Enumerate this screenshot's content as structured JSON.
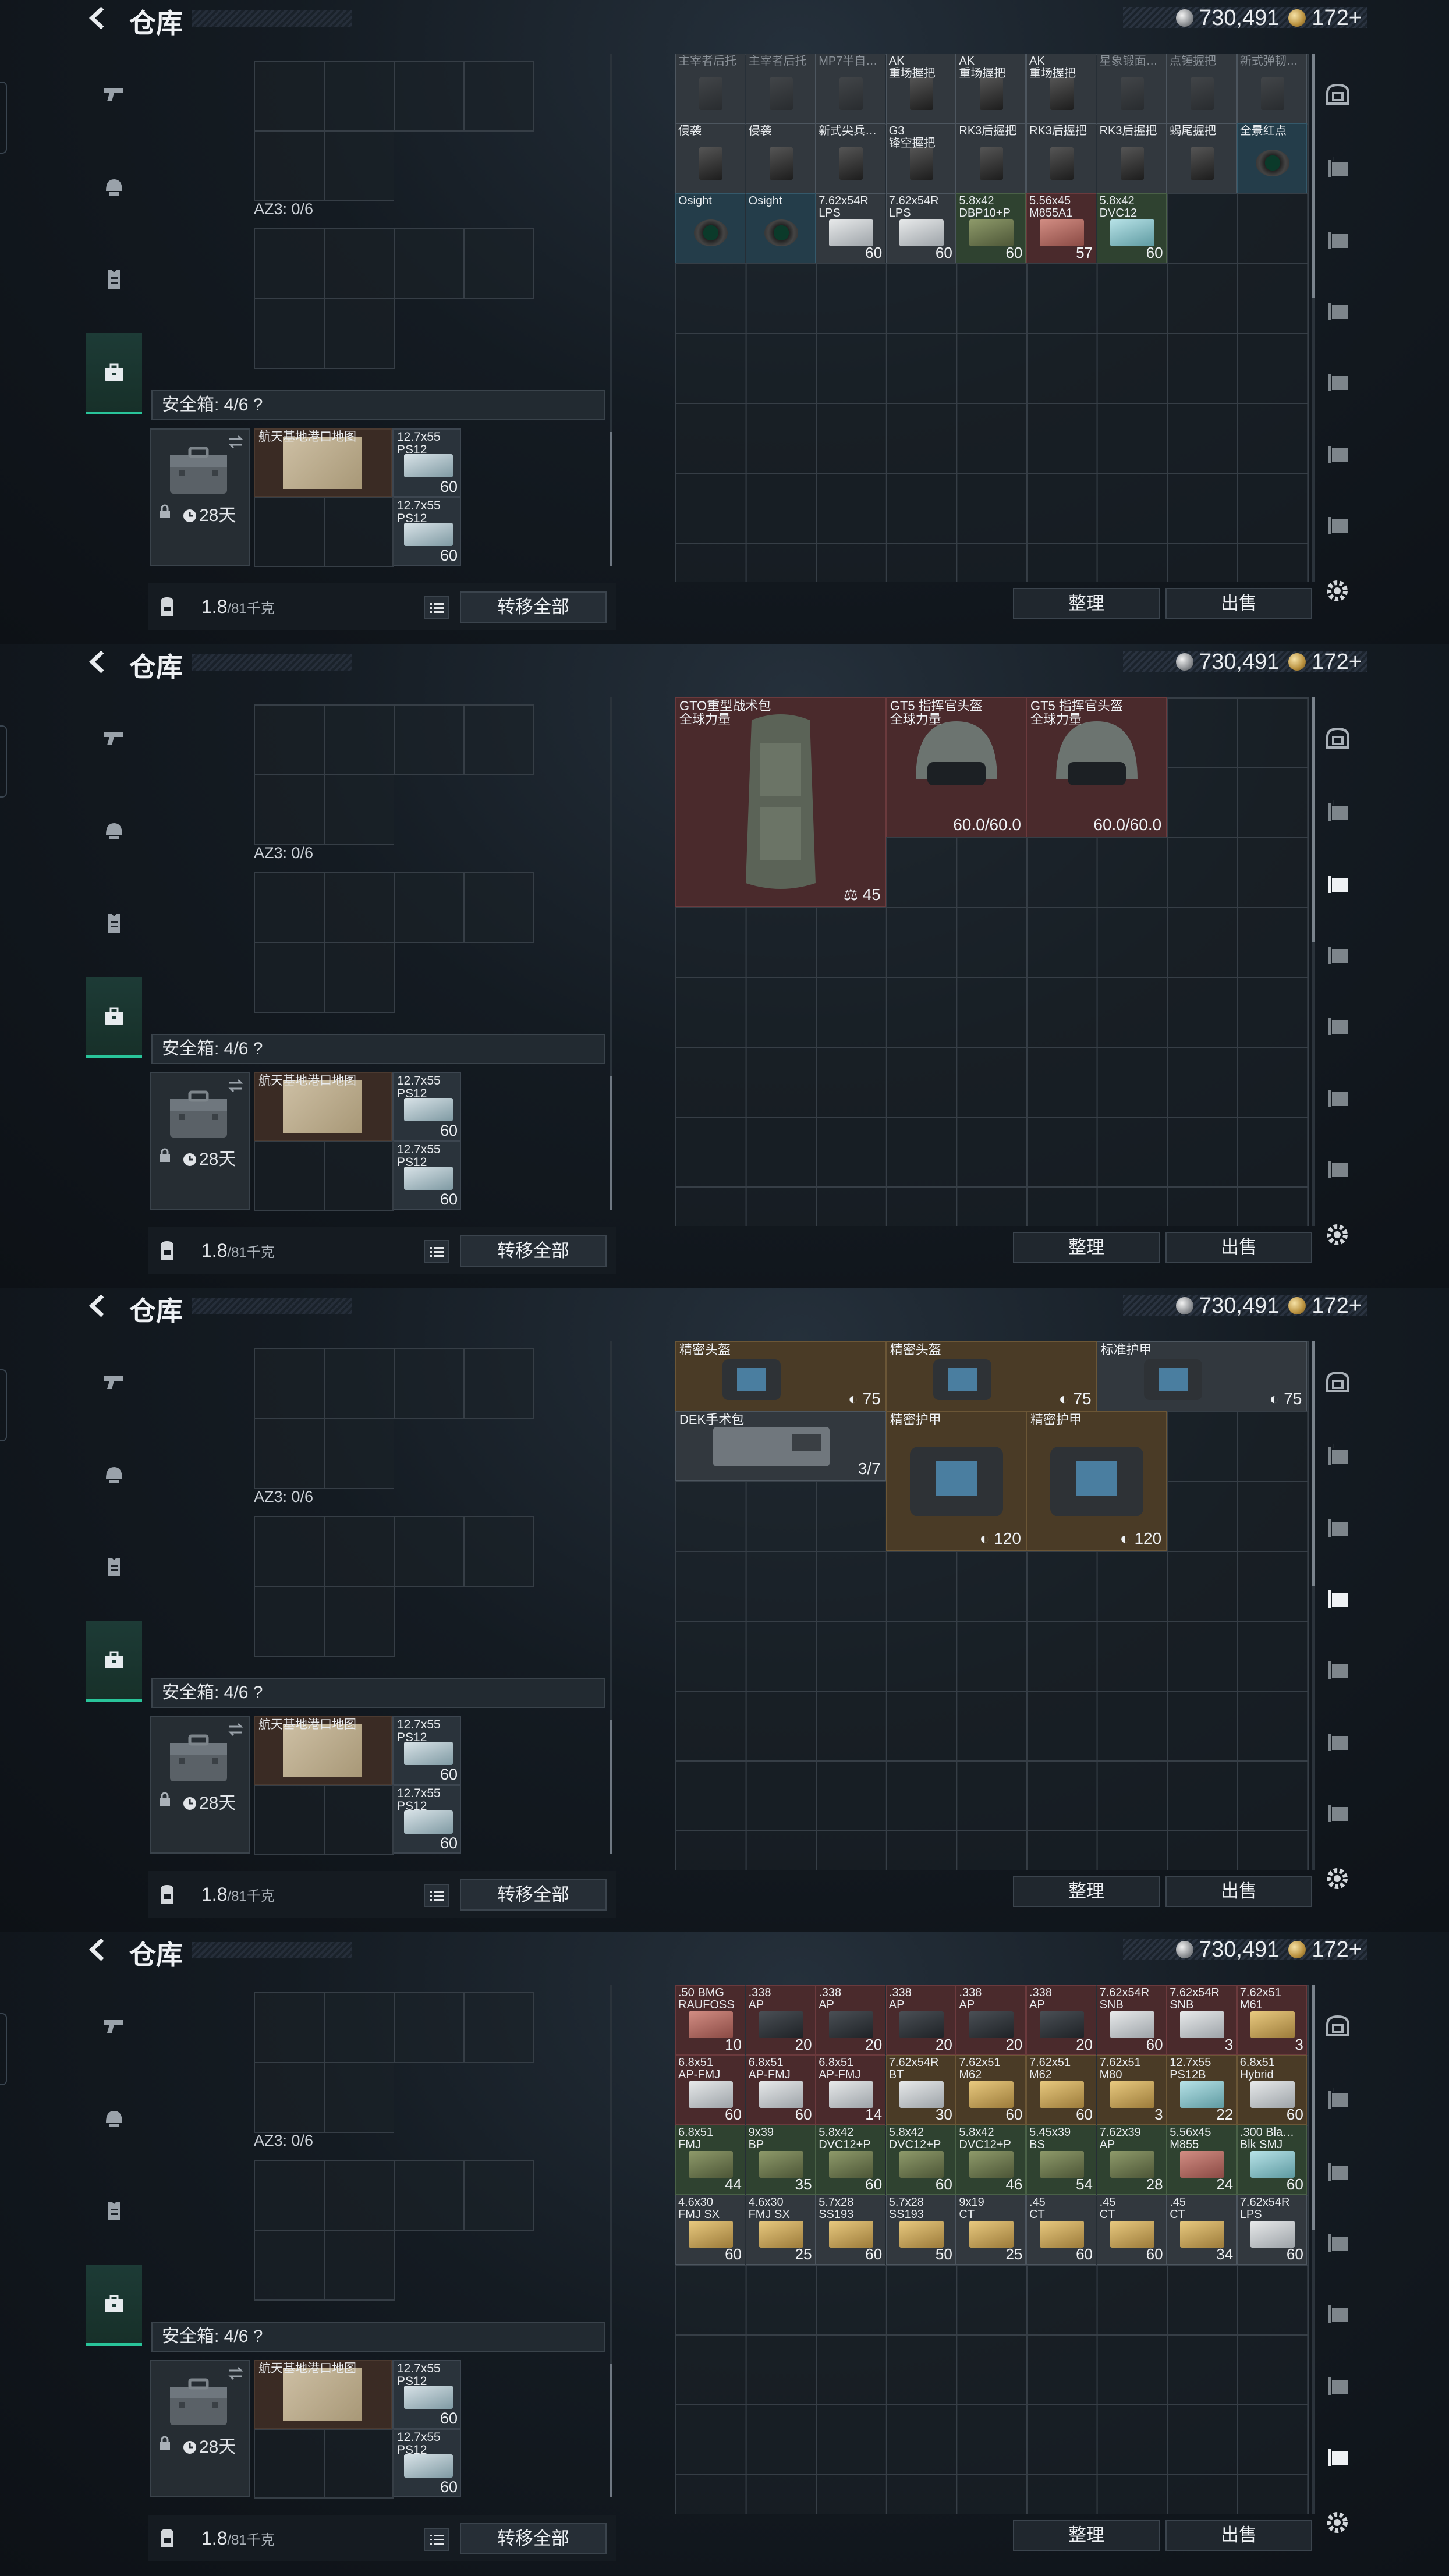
{
  "header": {
    "title": "仓库",
    "silver": "730,491",
    "gold": "172+"
  },
  "storage": {
    "az_label": "AZ3: 0/6",
    "safe_label": "安全箱: 4/6  ?",
    "case_days": "28天",
    "map_item": "航天基地港口地图",
    "ammo1_name": "12.7x55\nPS12",
    "ammo1_count": "60",
    "ammo2_name": "12.7x55\nPS12",
    "ammo2_count": "60",
    "weight_val": "1.8",
    "weight_unit": "/81千克",
    "transfer_all": "转移全部"
  },
  "buttons": {
    "sort": "整理",
    "sell": "出售"
  },
  "panel1_items": [
    {
      "name": "主宰者后托",
      "count": "",
      "style": "gray dim",
      "img": "grip"
    },
    {
      "name": "主宰者后托",
      "count": "",
      "style": "gray dim",
      "img": "grip"
    },
    {
      "name": "MP7半自…",
      "count": "",
      "style": "gray dim",
      "img": "grip"
    },
    {
      "name": "AK\n重场握把",
      "count": "",
      "style": "gray",
      "img": "grip"
    },
    {
      "name": "AK\n重场握把",
      "count": "",
      "style": "gray",
      "img": "grip"
    },
    {
      "name": "AK\n重场握把",
      "count": "",
      "style": "gray",
      "img": "grip"
    },
    {
      "name": "星象锻面…",
      "count": "",
      "style": "gray dim",
      "img": "grip"
    },
    {
      "name": "点锤握把",
      "count": "",
      "style": "gray dim",
      "img": "grip"
    },
    {
      "name": "新式弹韧…",
      "count": "",
      "style": "gray dim",
      "img": "grip"
    },
    {
      "name": "侵袭",
      "count": "",
      "style": "gray",
      "img": "grip"
    },
    {
      "name": "侵袭",
      "count": "",
      "style": "gray",
      "img": "grip"
    },
    {
      "name": "新式尖兵…",
      "count": "",
      "style": "gray",
      "img": "grip"
    },
    {
      "name": "G3\n锋空握把",
      "count": "",
      "style": "gray",
      "img": "grip"
    },
    {
      "name": "RK3后握把",
      "count": "",
      "style": "gray",
      "img": "grip"
    },
    {
      "name": "RK3后握把",
      "count": "",
      "style": "gray",
      "img": "grip"
    },
    {
      "name": "RK3后握把",
      "count": "",
      "style": "gray",
      "img": "grip"
    },
    {
      "name": "蝎尾握把",
      "count": "",
      "style": "gray",
      "img": "grip"
    },
    {
      "name": "全景红点",
      "count": "",
      "style": "blue",
      "img": "scope"
    },
    {
      "name": "Osight",
      "count": "",
      "style": "blue",
      "img": "scope"
    },
    {
      "name": "Osight",
      "count": "",
      "style": "blue",
      "img": "scope"
    },
    {
      "name": "7.62x54R\nLPS",
      "count": "60",
      "style": "gray",
      "img": "box"
    },
    {
      "name": "7.62x54R\nLPS",
      "count": "60",
      "style": "gray",
      "img": "box"
    },
    {
      "name": "5.8x42\nDBP10+P",
      "count": "60",
      "style": "green",
      "img": "olive"
    },
    {
      "name": "5.56x45\nM855A1",
      "count": "57",
      "style": "red",
      "img": "red"
    },
    {
      "name": "5.8x42\nDVC12",
      "count": "60",
      "style": "green",
      "img": "cyan"
    }
  ],
  "panel2_items": {
    "backpack_name": "GTO重型战术包\n全球力量",
    "backpack_count": "45",
    "helmet1_name": "GT5 指挥官头盔\n全球力量",
    "helmet1_dur": "60.0/60.0",
    "helmet2_name": "GT5 指挥官头盔\n全球力量",
    "helmet2_dur": "60.0/60.0"
  },
  "panel3_items": {
    "case1_name": "精密头盔",
    "case1_val": "75",
    "case2_name": "精密头盔",
    "case2_val": "75",
    "case3_name": "标准护甲",
    "case3_val": "75",
    "kit_name": "DEK手术包",
    "kit_val": "3/7",
    "case4_name": "精密护甲",
    "case4_val": "120",
    "case5_name": "精密护甲",
    "case5_val": "120"
  },
  "panel4_items": [
    {
      "name": ".50 BMG\nRAUFOSS",
      "count": "10",
      "style": "red",
      "img": "red"
    },
    {
      "name": ".338\nAP",
      "count": "20",
      "style": "red",
      "img": "dark"
    },
    {
      "name": ".338\nAP",
      "count": "20",
      "style": "red",
      "img": "dark"
    },
    {
      "name": ".338\nAP",
      "count": "20",
      "style": "red",
      "img": "dark"
    },
    {
      "name": ".338\nAP",
      "count": "20",
      "style": "red",
      "img": "dark"
    },
    {
      "name": ".338\nAP",
      "count": "20",
      "style": "red",
      "img": "dark"
    },
    {
      "name": "7.62x54R\nSNB",
      "count": "60",
      "style": "red",
      "img": "box"
    },
    {
      "name": "7.62x54R\nSNB",
      "count": "3",
      "style": "red",
      "img": "box"
    },
    {
      "name": "7.62x51\nM61",
      "count": "3",
      "style": "red",
      "img": "brass"
    },
    {
      "name": "6.8x51\nAP-FMJ",
      "count": "60",
      "style": "red",
      "img": "box"
    },
    {
      "name": "6.8x51\nAP-FMJ",
      "count": "60",
      "style": "red",
      "img": "box"
    },
    {
      "name": "6.8x51\nAP-FMJ",
      "count": "14",
      "style": "red",
      "img": "box"
    },
    {
      "name": "7.62x54R\nBT",
      "count": "30",
      "style": "tan",
      "img": "box"
    },
    {
      "name": "7.62x51\nM62",
      "count": "60",
      "style": "tan",
      "img": "brass"
    },
    {
      "name": "7.62x51\nM62",
      "count": "60",
      "style": "tan",
      "img": "brass"
    },
    {
      "name": "7.62x51\nM80",
      "count": "3",
      "style": "tan",
      "img": "brass"
    },
    {
      "name": "12.7x55\nPS12B",
      "count": "22",
      "style": "tan",
      "img": "cyan"
    },
    {
      "name": "6.8x51\nHybrid",
      "count": "60",
      "style": "tan",
      "img": "box"
    },
    {
      "name": "6.8x51\nFMJ",
      "count": "44",
      "style": "green",
      "img": "olive"
    },
    {
      "name": "9x39\nBP",
      "count": "35",
      "style": "green",
      "img": "olive"
    },
    {
      "name": "5.8x42\nDVC12+P",
      "count": "60",
      "style": "green",
      "img": "olive"
    },
    {
      "name": "5.8x42\nDVC12+P",
      "count": "60",
      "style": "green",
      "img": "olive"
    },
    {
      "name": "5.8x42\nDVC12+P",
      "count": "46",
      "style": "green",
      "img": "olive"
    },
    {
      "name": "5.45x39\nBS",
      "count": "54",
      "style": "green",
      "img": "olive"
    },
    {
      "name": "7.62x39\nAP",
      "count": "28",
      "style": "green",
      "img": "olive"
    },
    {
      "name": "5.56x45\nM855",
      "count": "24",
      "style": "green",
      "img": "red"
    },
    {
      "name": ".300 Bla…\nBlk SMJ",
      "count": "60",
      "style": "green",
      "img": "cyan"
    },
    {
      "name": "4.6x30\nFMJ SX",
      "count": "60",
      "style": "gray",
      "img": "brass"
    },
    {
      "name": "4.6x30\nFMJ SX",
      "count": "25",
      "style": "gray",
      "img": "brass"
    },
    {
      "name": "5.7x28\nSS193",
      "count": "60",
      "style": "gray",
      "img": "brass"
    },
    {
      "name": "5.7x28\nSS193",
      "count": "50",
      "style": "gray",
      "img": "brass"
    },
    {
      "name": "9x19\nCT",
      "count": "25",
      "style": "gray",
      "img": "brass"
    },
    {
      "name": ".45\nCT",
      "count": "60",
      "style": "gray",
      "img": "brass"
    },
    {
      "name": ".45\nCT",
      "count": "60",
      "style": "gray",
      "img": "brass"
    },
    {
      "name": ".45\nCT",
      "count": "34",
      "style": "gray",
      "img": "brass"
    },
    {
      "name": "7.62x54R\nLPS",
      "count": "60",
      "style": "gray",
      "img": "box"
    }
  ]
}
